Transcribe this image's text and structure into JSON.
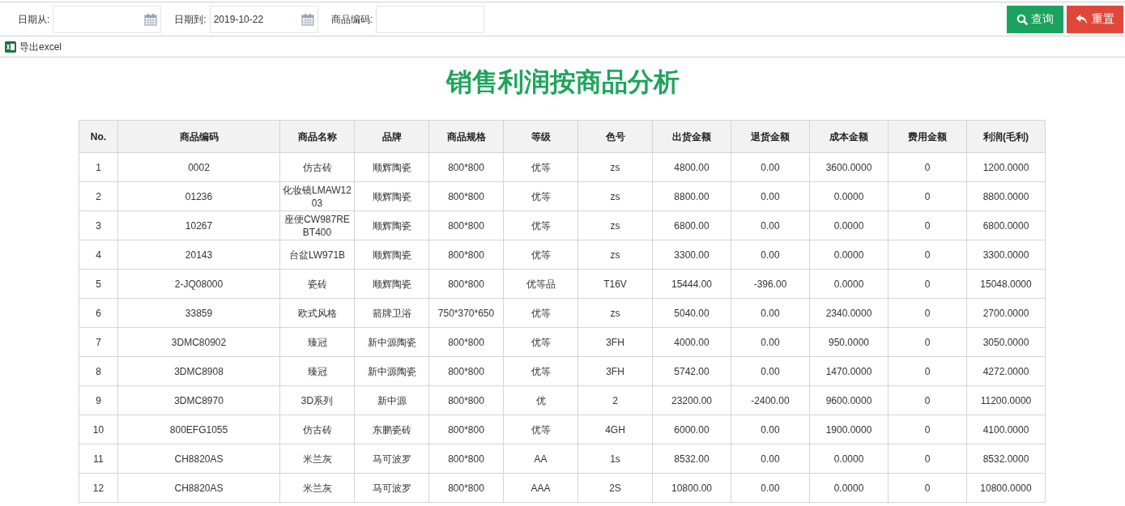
{
  "filters": [
    {
      "label": "日期从:",
      "kind": "date"
    },
    {
      "label": "日期到:",
      "value": "2019-10-22",
      "kind": "date"
    },
    {
      "label": "商品编码:",
      "kind": "text"
    }
  ],
  "buttons": [
    {
      "label": "查询",
      "kind": "search"
    },
    {
      "label": "重置",
      "kind": "reset"
    }
  ],
  "export_link": "导出excel",
  "title": "销售利润按商品分析",
  "table": {
    "columns": [
      "No.",
      "商品编码",
      "商品名称",
      "品牌",
      "商品规格",
      "等级",
      "色号",
      "出货金额",
      "退货金额",
      "成本金额",
      "费用金额",
      "利润(毛利)"
    ],
    "rows": [
      [
        "1",
        "0002",
        "仿古砖",
        "顺辉陶瓷",
        "800*800",
        "优等",
        "zs",
        "4800.00",
        "0.00",
        "3600.0000",
        "0",
        "1200.0000"
      ],
      [
        "2",
        "01236",
        "化妆镜LMAW1203",
        "顺辉陶瓷",
        "800*800",
        "优等",
        "zs",
        "8800.00",
        "0.00",
        "0.0000",
        "0",
        "8800.0000"
      ],
      [
        "3",
        "10267",
        "座便CW987REBT400",
        "顺辉陶瓷",
        "800*800",
        "优等",
        "zs",
        "6800.00",
        "0.00",
        "0.0000",
        "0",
        "6800.0000"
      ],
      [
        "4",
        "20143",
        "台盆LW971B",
        "顺辉陶瓷",
        "800*800",
        "优等",
        "zs",
        "3300.00",
        "0.00",
        "0.0000",
        "0",
        "3300.0000"
      ],
      [
        "5",
        "2-JQ08000",
        "瓷砖",
        "顺辉陶瓷",
        "800*800",
        "优等品",
        "T16V",
        "15444.00",
        "-396.00",
        "0.0000",
        "0",
        "15048.0000"
      ],
      [
        "6",
        "33859",
        "欧式风格",
        "箭牌卫浴",
        "750*370*650",
        "优等",
        "zs",
        "5040.00",
        "0.00",
        "2340.0000",
        "0",
        "2700.0000"
      ],
      [
        "7",
        "3DMC80902",
        "臻冠",
        "新中源陶瓷",
        "800*800",
        "优等",
        "3FH",
        "4000.00",
        "0.00",
        "950.0000",
        "0",
        "3050.0000"
      ],
      [
        "8",
        "3DMC8908",
        "臻冠",
        "新中源陶瓷",
        "800*800",
        "优等",
        "3FH",
        "5742.00",
        "0.00",
        "1470.0000",
        "0",
        "4272.0000"
      ],
      [
        "9",
        "3DMC8970",
        "3D系列",
        "新中源",
        "800*800",
        "优",
        "2",
        "23200.00",
        "-2400.00",
        "9600.0000",
        "0",
        "11200.0000"
      ],
      [
        "10",
        "800EFG1055",
        "仿古砖",
        "东鹏瓷砖",
        "800*800",
        "优等",
        "4GH",
        "6000.00",
        "0.00",
        "1900.0000",
        "0",
        "4100.0000"
      ],
      [
        "11",
        "CH8820AS",
        "米兰灰",
        "马可波罗",
        "800*800",
        "AA",
        "1s",
        "8532.00",
        "0.00",
        "0.0000",
        "0",
        "8532.0000"
      ],
      [
        "12",
        "CH8820AS",
        "米兰灰",
        "马可波罗",
        "800*800",
        "AAA",
        "2S",
        "10800.00",
        "0.00",
        "0.0000",
        "0",
        "10800.0000"
      ]
    ]
  }
}
